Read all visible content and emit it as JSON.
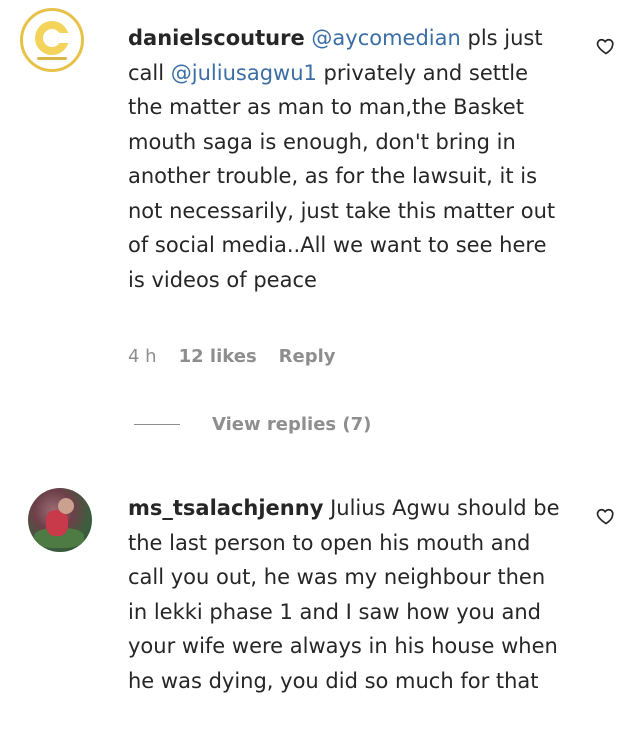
{
  "comments": [
    {
      "username": "danielscouture",
      "mention": "@aycomedian",
      "text_part1": " pls just call ",
      "mention2": "@juliusagwu1",
      "text_part2": " privately and settle the matter as man to man,the Basket mouth saga is enough, don't bring in another trouble, as for the lawsuit, it is not necessarily, just take this matter out of social media..All we want to see here is videos of peace",
      "time": "4 h",
      "likes": "12 likes",
      "reply_label": "Reply",
      "view_replies": "View replies (7)",
      "avatar_icon": "couture-logo-avatar",
      "like_icon": "heart-outline-icon"
    },
    {
      "username": "ms_tsalachjenny",
      "text": " Julius Agwu should be the last person to open his mouth and call you out, he was my neighbour then in lekki phase 1 and I saw how you and your wife were always in his house when he was dying, you did so much for that",
      "avatar_icon": "profile-photo-avatar",
      "like_icon": "heart-outline-icon"
    }
  ],
  "colors": {
    "mention": "#3b6ea5",
    "meta": "#8e8e8e",
    "text": "#262626",
    "avatar_ring": "#e7c24a"
  }
}
